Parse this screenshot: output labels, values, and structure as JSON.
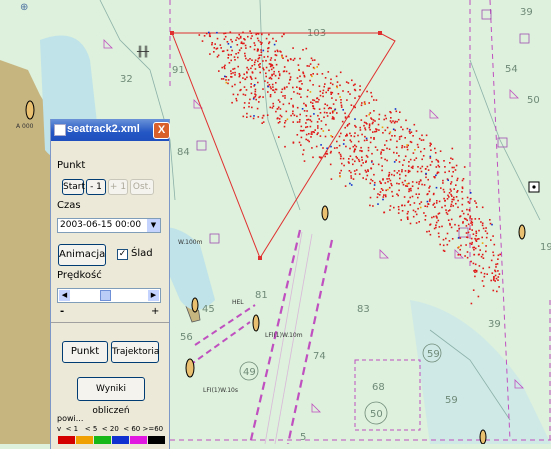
{
  "window": {
    "title": "seatrack2.xml",
    "close": "X"
  },
  "punkt_section": {
    "label": "Punkt",
    "start": "Start",
    "minus1": "- 1",
    "plus1": "+ 1",
    "ost": "Ost."
  },
  "czas": {
    "label": "Czas",
    "value": "2003-06-15 00:00"
  },
  "animation": {
    "button": "Animacja",
    "trail_label": "Ślad",
    "trail_checked": "✓"
  },
  "speed": {
    "label": "Prędkość",
    "min": "-",
    "max": "+"
  },
  "view_toggle": {
    "punkt": "Punkt",
    "trajektoria": "Trajektoria"
  },
  "results_button": "Wyniki obliczeń",
  "legend": {
    "title": "powi...",
    "ranges": "v  < 1   < 5  < 20  < 60 >=60",
    "colors": [
      "#d40000",
      "#f0a000",
      "#18b818",
      "#1030d0",
      "#e018e0",
      "#000000"
    ]
  },
  "map": {
    "depths": [
      "103",
      "91",
      "54",
      "50",
      "32",
      "84",
      "81",
      "83",
      "68",
      "39",
      "59",
      "74",
      "56",
      "45",
      "49",
      "50",
      "59",
      "19",
      "39",
      "5"
    ],
    "labels": [
      "A 000",
      "HEL",
      "LFI(1)W.10s",
      "LFl(1)W.10m",
      "W.100m"
    ]
  }
}
